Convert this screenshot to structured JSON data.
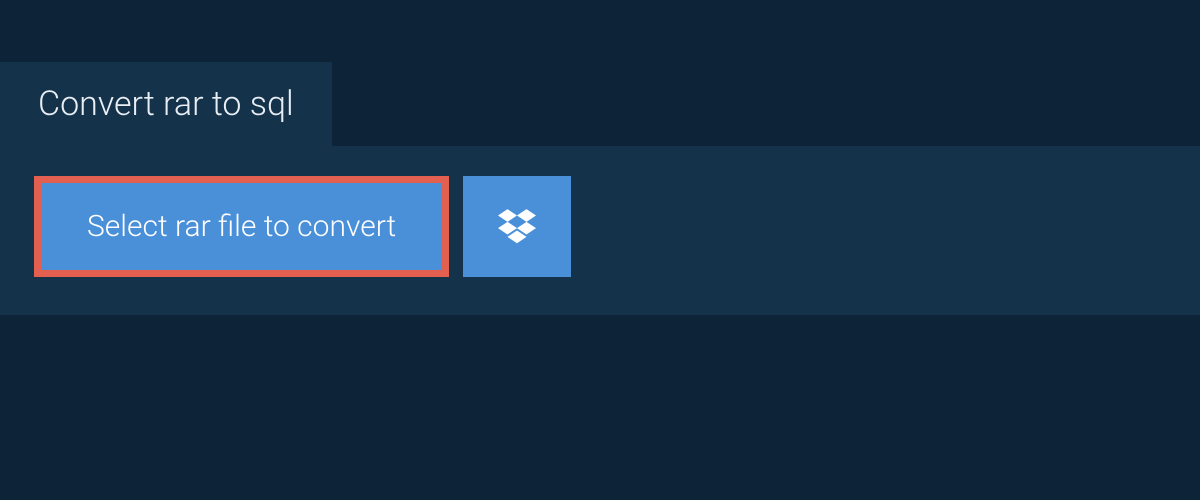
{
  "tab": {
    "label": "Convert rar to sql"
  },
  "actions": {
    "select_file_label": "Select rar file to convert"
  },
  "colors": {
    "background": "#0d2438",
    "panel": "#15324b",
    "button": "#4a90d9",
    "highlight_border": "#e35f4f",
    "text_light": "#e8eef3"
  }
}
